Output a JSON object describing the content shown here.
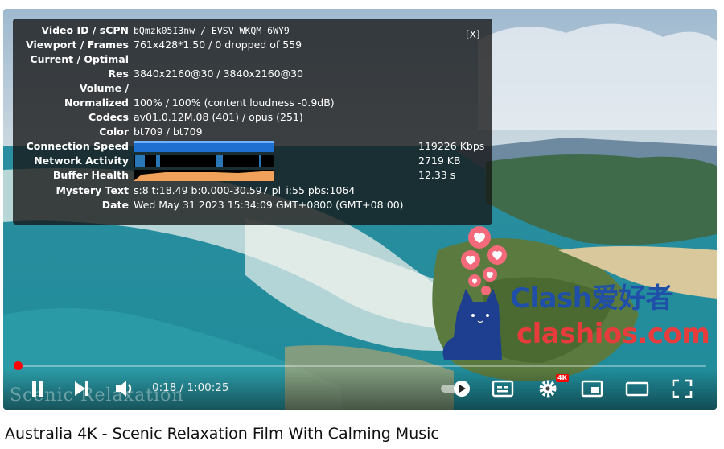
{
  "stats": {
    "close_label": "[X]",
    "rows": [
      {
        "label": "Video ID / sCPN",
        "value": "bQmzk05I3nw / EVSV WKQM 6WY9"
      },
      {
        "label": "Viewport / Frames",
        "value": "761x428*1.50 / 0 dropped of 559"
      },
      {
        "label": "Current / Optimal",
        "value": ""
      },
      {
        "label": "Res",
        "value": "3840x2160@30 / 3840x2160@30"
      },
      {
        "label": "Volume /",
        "value": ""
      },
      {
        "label": "Normalized",
        "value": "100% / 100% (content loudness -0.9dB)"
      },
      {
        "label": "Codecs",
        "value": "av01.0.12M.08 (401) / opus (251)"
      },
      {
        "label": "Color",
        "value": "bt709 / bt709"
      },
      {
        "label": "Connection Speed",
        "value": "119226 Kbps"
      },
      {
        "label": "Network Activity",
        "value": "2719 KB"
      },
      {
        "label": "Buffer Health",
        "value": "12.33 s"
      },
      {
        "label": "Mystery Text",
        "value": "s:8 t:18.49 b:0.000-30.597 pl_i:55 pbs:1064"
      },
      {
        "label": "Date",
        "value": "Wed May 31 2023 15:34:09 GMT+0800 (GMT+08:00)"
      }
    ]
  },
  "watermark": {
    "line1": "Clash爱好者",
    "line2": "clashios.com"
  },
  "player": {
    "overlay_text": "Scenic Relaxation",
    "time": "0:18 / 1:00:25",
    "progress_fraction": 0.005,
    "quality_badge": "4K"
  },
  "video_title": "Australia 4K - Scenic Relaxation Film With Calming Music",
  "colors": {
    "progress": "#ff0000",
    "stats_bg": "#141414"
  }
}
